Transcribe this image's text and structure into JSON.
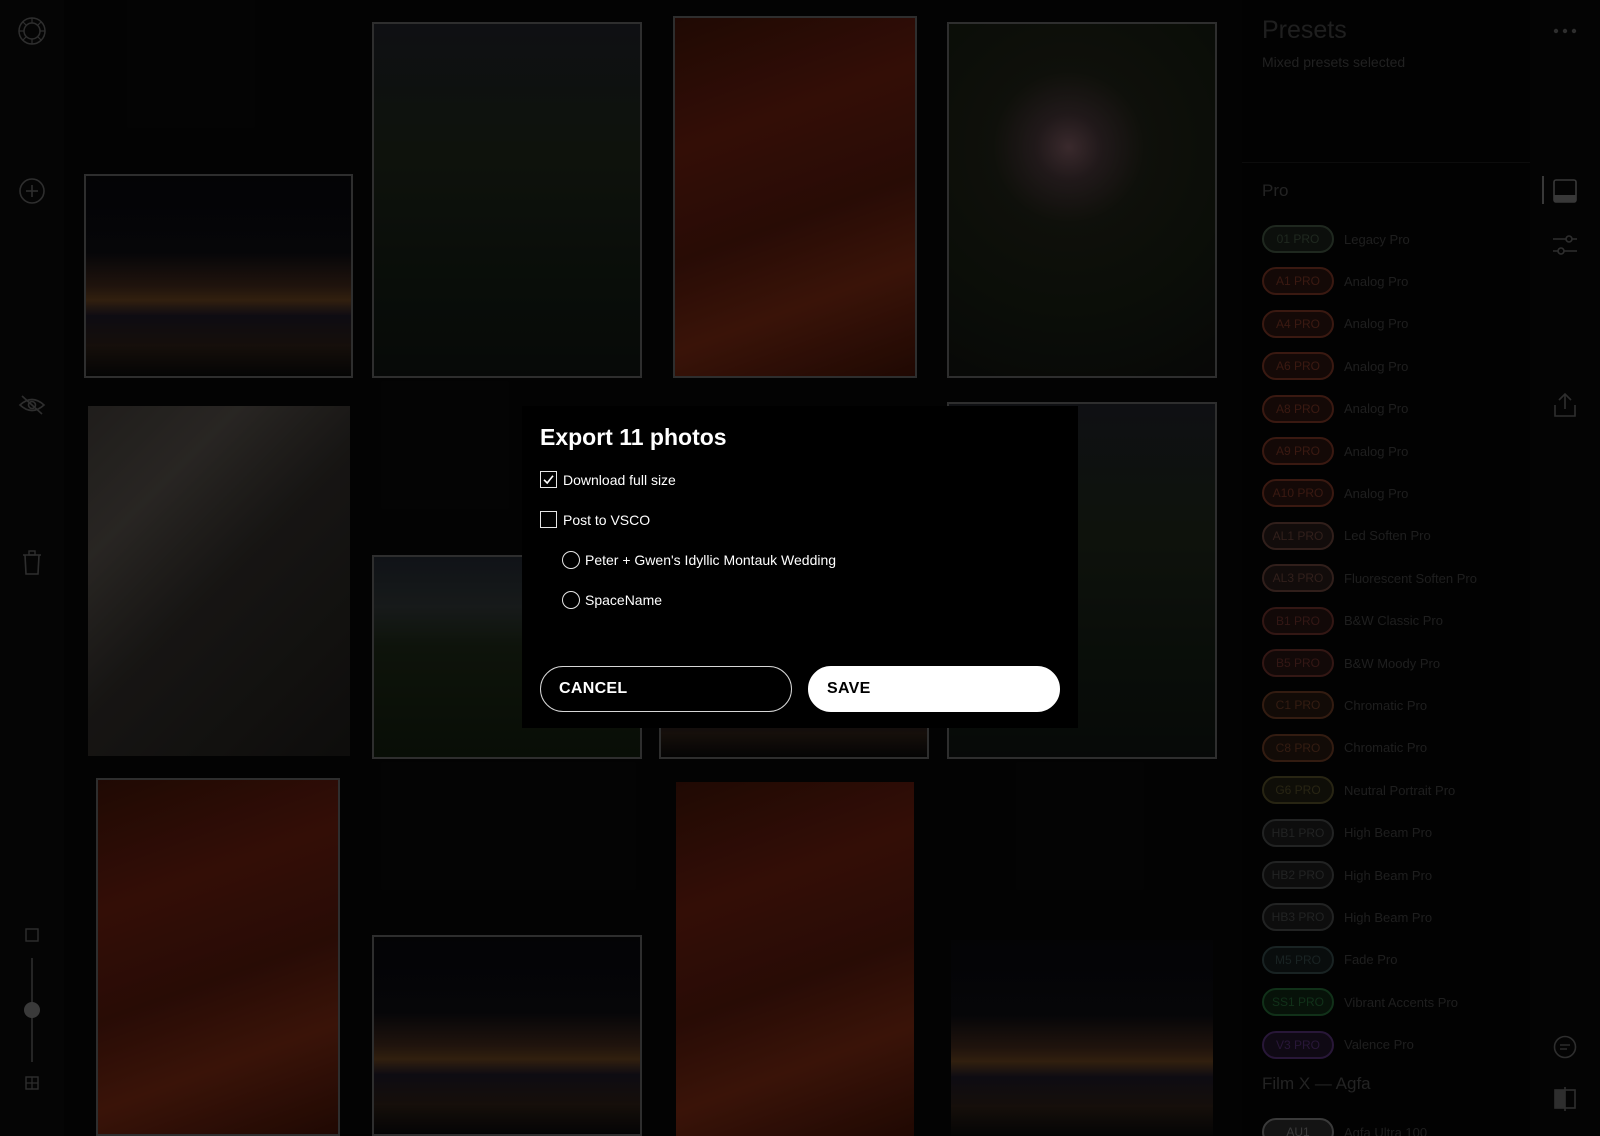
{
  "app": {
    "rail_icons": [
      "vsco-logo-icon",
      "add-icon",
      "hide-icon",
      "trash-icon",
      "square-view-icon",
      "grid-view-icon"
    ],
    "zoom_level": 0.5
  },
  "grid": {
    "photos": [
      "night-buildings",
      "river-palms",
      "red-decor",
      "rose-garden",
      "cloth-table",
      "leaves-sky",
      "night-buildings",
      "river-palms",
      "red-decor",
      "night-buildings",
      "red-decor",
      "night-buildings"
    ]
  },
  "presets": {
    "title": "Presets",
    "subtitle": "Mixed presets selected",
    "sections": [
      {
        "title": "Pro",
        "items": [
          {
            "code": "01 PRO",
            "name": "Legacy Pro",
            "color": "#3a4a3a"
          },
          {
            "code": "A1 PRO",
            "name": "Analog Pro",
            "color": "#6a2e20"
          },
          {
            "code": "A4 PRO",
            "name": "Analog Pro",
            "color": "#6a2e20"
          },
          {
            "code": "A6 PRO",
            "name": "Analog Pro",
            "color": "#6a2e20"
          },
          {
            "code": "A8 PRO",
            "name": "Analog Pro",
            "color": "#6a2e20"
          },
          {
            "code": "A9 PRO",
            "name": "Analog Pro",
            "color": "#6a2e20"
          },
          {
            "code": "A10 PRO",
            "name": "Analog Pro",
            "color": "#6a2e20"
          },
          {
            "code": "AL1 PRO",
            "name": "Led Soften Pro",
            "color": "#5a3a32"
          },
          {
            "code": "AL3 PRO",
            "name": "Fluorescent Soften Pro",
            "color": "#5a3a32"
          },
          {
            "code": "B1 PRO",
            "name": "B&W Classic Pro",
            "color": "#5e2a26"
          },
          {
            "code": "B5 PRO",
            "name": "B&W Moody Pro",
            "color": "#5e2a26"
          },
          {
            "code": "C1 PRO",
            "name": "Chromatic Pro",
            "color": "#5e3420"
          },
          {
            "code": "C8 PRO",
            "name": "Chromatic Pro",
            "color": "#5e3420"
          },
          {
            "code": "G6 PRO",
            "name": "Neutral Portrait Pro",
            "color": "#4a4424"
          },
          {
            "code": "HB1 PRO",
            "name": "High Beam Pro",
            "color": "#3e4040"
          },
          {
            "code": "HB2 PRO",
            "name": "High Beam Pro",
            "color": "#3e4040"
          },
          {
            "code": "HB3 PRO",
            "name": "High Beam Pro",
            "color": "#3e4040"
          },
          {
            "code": "M5 PRO",
            "name": "Fade Pro",
            "color": "#2e4040"
          },
          {
            "code": "SS1 PRO",
            "name": "Vibrant Accents Pro",
            "color": "#1f5a2e"
          },
          {
            "code": "V3 PRO",
            "name": "Valence Pro",
            "color": "#4a2a66"
          }
        ]
      },
      {
        "title": "Film X — Agfa",
        "items": [
          {
            "code": "AU1",
            "name": "Agfa Ultra 100",
            "color": "#6a6a6a"
          }
        ]
      }
    ]
  },
  "toolbar": {
    "icons": [
      "more-icon",
      "presets-icon",
      "adjust-icon",
      "export-icon",
      "comment-icon",
      "compare-icon"
    ]
  },
  "modal": {
    "title": "Export 11 photos",
    "options": {
      "download_full_size": {
        "label": "Download full size",
        "checked": true
      },
      "post_to_vsco": {
        "label": "Post to VSCO",
        "checked": false
      }
    },
    "spaces": [
      {
        "label": "Peter + Gwen's Idyllic Montauk Wedding",
        "selected": false
      },
      {
        "label": "SpaceName",
        "selected": false
      }
    ],
    "cancel_label": "CANCEL",
    "save_label": "SAVE"
  }
}
